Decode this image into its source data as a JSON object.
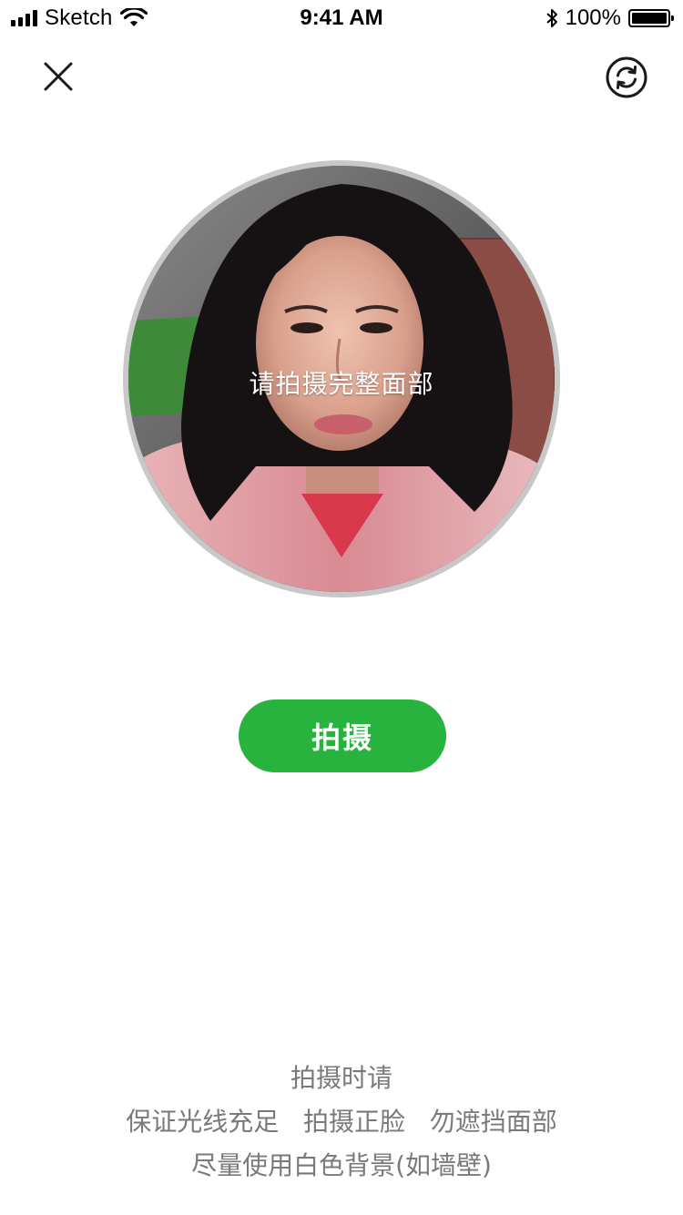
{
  "status_bar": {
    "carrier": "Sketch",
    "time": "9:41 AM",
    "battery_percent": "100%",
    "battery_level": 1.0,
    "icons": [
      "signal-icon",
      "wifi-icon",
      "bluetooth-icon",
      "battery-icon"
    ]
  },
  "toolbar": {
    "close_icon": "close-icon",
    "switch_camera_icon": "switch-camera-icon"
  },
  "preview": {
    "hint": "请拍摄完整面部"
  },
  "capture": {
    "label": "拍摄",
    "color": "#27b33e"
  },
  "tips": {
    "title": "拍摄时请",
    "line1": "保证光线充足   拍摄正脸   勿遮挡面部",
    "line2": "尽量使用白色背景(如墙壁)"
  }
}
